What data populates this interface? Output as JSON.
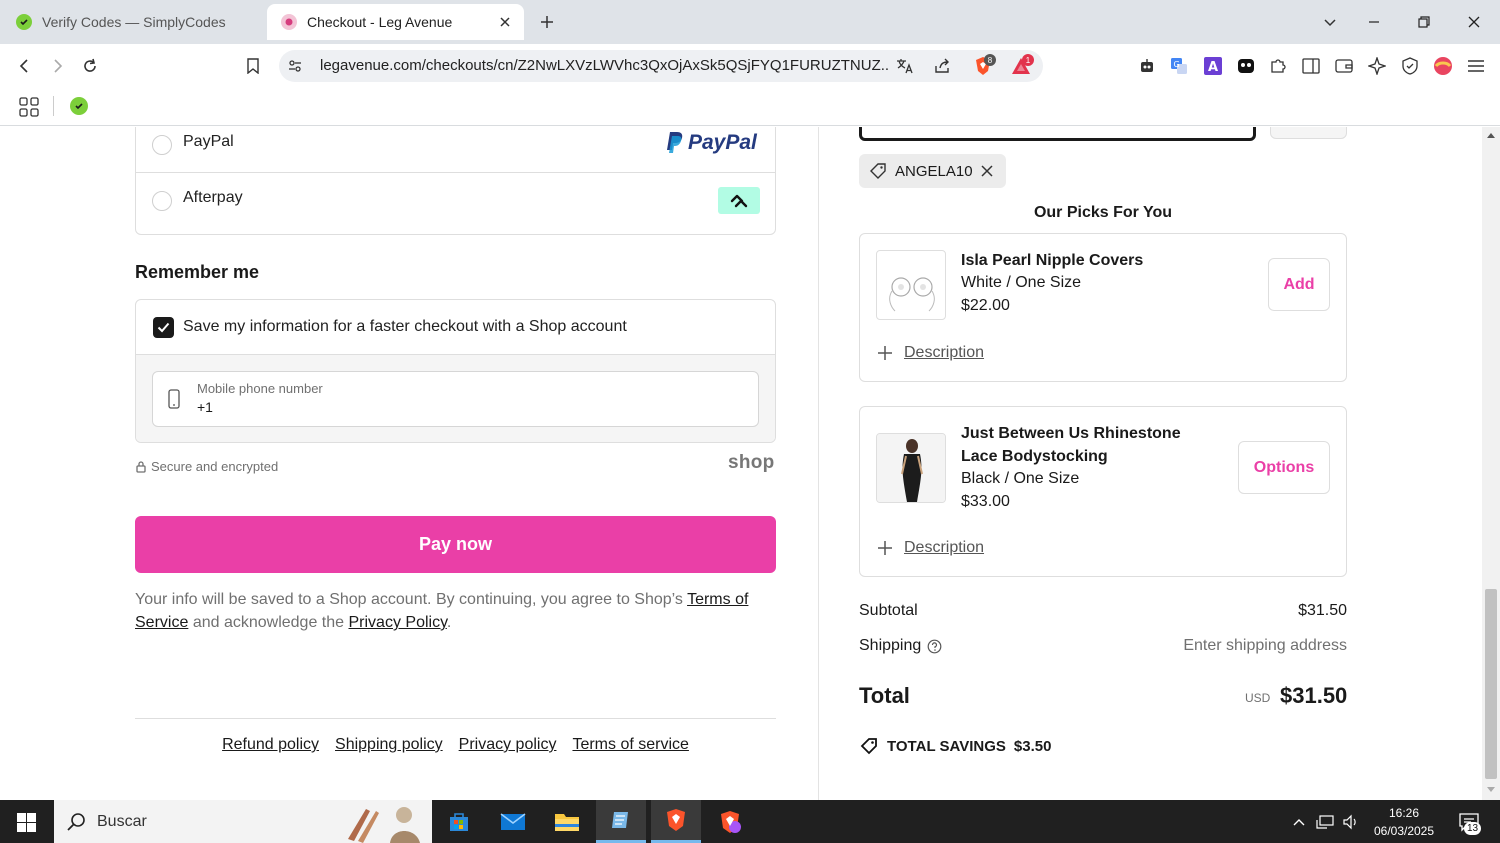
{
  "browser": {
    "tabs": [
      {
        "title": "Verify Codes — SimplyCodes",
        "active": false
      },
      {
        "title": "Checkout - Leg Avenue",
        "active": true
      }
    ],
    "url": "legavenue.com/checkouts/cn/Z2NwLXVzLWVhc3QxOjAxSk5QSjFYQ1FURUZTNUZ...",
    "brave_shield_count": "8",
    "rewards_count": "1"
  },
  "payment": {
    "options": [
      {
        "label": "PayPal",
        "logo_text": "PayPal"
      },
      {
        "label": "Afterpay"
      }
    ]
  },
  "remember": {
    "title": "Remember me",
    "checkbox_label": "Save my information for a faster checkout with a Shop account",
    "checked": true,
    "phone_label": "Mobile phone number",
    "phone_value": "+1",
    "secure_text": "Secure and encrypted",
    "shop_logo": "shop"
  },
  "pay_button": "Pay now",
  "legal": {
    "text_before": "Your info will be saved to a Shop account. By continuing, you agree to Shop’s",
    "terms_link": "Terms of Service",
    "text_middle": "and acknowledge the",
    "privacy_link": "Privacy Policy",
    "text_end": "."
  },
  "footer_links": [
    "Refund policy",
    "Shipping policy",
    "Privacy policy",
    "Terms of service"
  ],
  "discount": {
    "code": "ANGELA10"
  },
  "picks": {
    "title": "Our Picks For You",
    "items": [
      {
        "name": "Isla Pearl Nipple Covers",
        "variant": "White / One Size",
        "price": "$22.00",
        "button": "Add",
        "desc": "Description"
      },
      {
        "name_line1": "Just Between Us Rhinestone",
        "name_line2": "Lace Bodystocking",
        "variant": "Black / One Size",
        "price": "$33.00",
        "button": "Options",
        "desc": "Description"
      }
    ]
  },
  "summary": {
    "subtotal_label": "Subtotal",
    "subtotal_value": "$31.50",
    "shipping_label": "Shipping",
    "shipping_value": "Enter shipping address",
    "total_label": "Total",
    "currency": "USD",
    "total_value": "$31.50",
    "savings_label": "TOTAL SAVINGS",
    "savings_value": "$3.50"
  },
  "taskbar": {
    "search_placeholder": "Buscar",
    "time": "16:26",
    "date": "06/03/2025",
    "notifications": "13"
  },
  "colors": {
    "accent": "#ea3fa7",
    "afterpay": "#b2fce4"
  }
}
